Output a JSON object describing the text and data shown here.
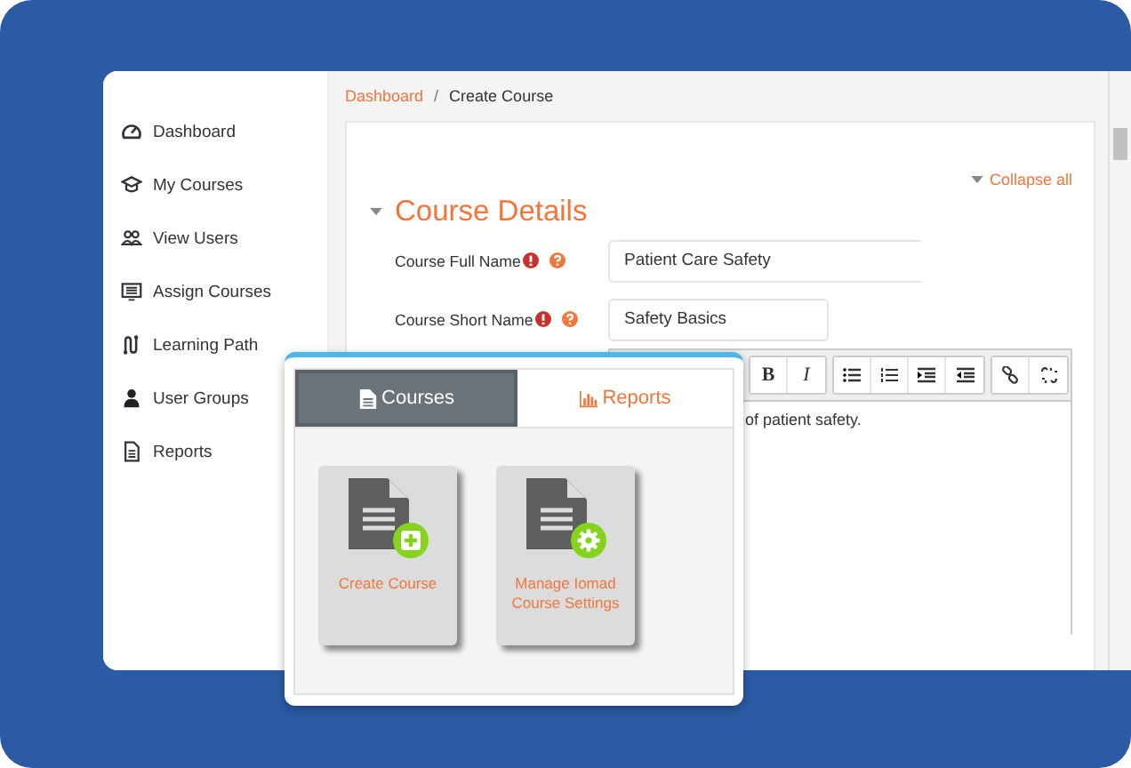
{
  "sidebar": {
    "items": [
      {
        "label": "Dashboard"
      },
      {
        "label": "My Courses"
      },
      {
        "label": "View Users"
      },
      {
        "label": "Assign Courses"
      },
      {
        "label": "Learning Path"
      },
      {
        "label": "User Groups"
      },
      {
        "label": "Reports"
      }
    ]
  },
  "breadcrumb": {
    "link": "Dashboard",
    "separator": "/",
    "current": "Create Course"
  },
  "collapse_all": "Collapse all",
  "section": {
    "title": "Course Details",
    "expanded": true
  },
  "fields": [
    {
      "label": "Course Full Name",
      "value": "Patient Care Safety"
    },
    {
      "label": "Course Short Name",
      "value": "Safety Basics"
    }
  ],
  "editor": {
    "toolbar_texts": [
      "B",
      "I"
    ],
    "text": "of patient safety."
  },
  "popup": {
    "tabs": [
      {
        "label": "Courses",
        "selected": true
      },
      {
        "label": "Reports",
        "selected": false
      }
    ],
    "tiles": [
      {
        "label": "Create Course"
      },
      {
        "label": "Manage Iomad Course Settings"
      }
    ]
  }
}
